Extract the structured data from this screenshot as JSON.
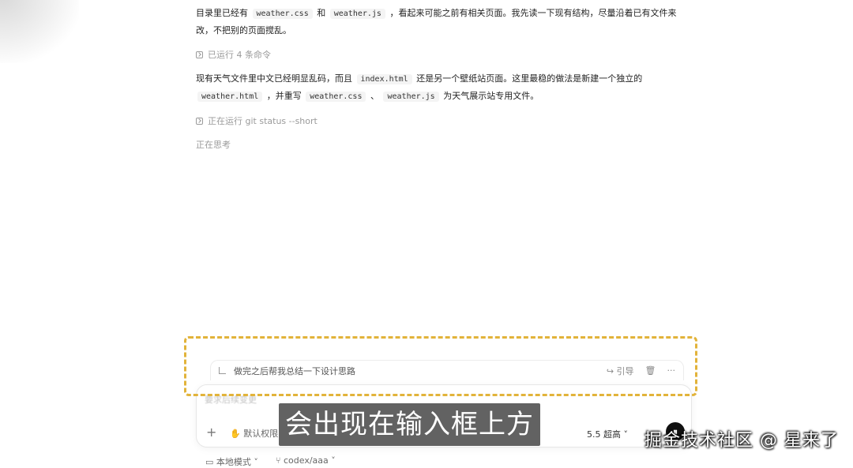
{
  "messages": {
    "para1_before_code1": "目录里已经有",
    "para1_code1": "weather.css",
    "para1_and": "和",
    "para1_code2": "weather.js",
    "para1_after": "，看起来可能之前有相关页面。我先读一下现有结构，尽量沿着已有文件来改，不把别的页面搅乱。",
    "cmd_ran": "已运行 4 条命令",
    "para2_before": "现有天气文件里中文已经明显乱码，而且",
    "para2_code1": "index.html",
    "para2_mid": "还是另一个壁纸站页面。这里最稳的做法是新建一个独立的",
    "para2_code2": "weather.html",
    "para2_rewrite": "，并重写",
    "para2_code3": "weather.css",
    "para2_sep": "、",
    "para2_code4": "weather.js",
    "para2_end": "为天气展示站专用文件。",
    "cmd_running": "正在运行 git status --short",
    "thinking": "正在思考"
  },
  "queued": {
    "text": "做完之后帮我总结一下设计思路",
    "guide_label": "↪ 引导",
    "delete_icon": "trash-icon",
    "more_label": "···"
  },
  "composer": {
    "placeholder": "要求后续变更",
    "plus_label": "+",
    "permission_label": "✋ 默认权限",
    "model_label": "5.5  超高 ˅",
    "send_label": "⏸"
  },
  "footer": {
    "mode_label": "▭ 本地模式 ˅",
    "branch_label": "⑂ codex/aaa ˅"
  },
  "overlay": {
    "subtitle": "会出现在输入框上方",
    "watermark": "掘金技术社区 @ 星来了"
  },
  "colors": {
    "highlight_dash": "#e2b33a",
    "muted_text": "#9a9a9a"
  }
}
